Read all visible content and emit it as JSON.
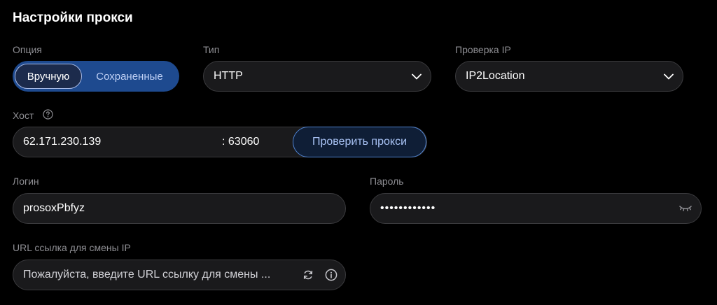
{
  "header": {
    "title": "Настройки прокси"
  },
  "option": {
    "label": "Опция",
    "tabs": [
      {
        "label": "Вручную"
      },
      {
        "label": "Сохраненные"
      }
    ]
  },
  "type": {
    "label": "Тип",
    "value": "HTTP"
  },
  "ip_check": {
    "label": "Проверка IP",
    "value": "IP2Location"
  },
  "host": {
    "label": "Хост",
    "address": "62.171.230.139",
    "port": ": 63060",
    "check_button": "Проверить прокси"
  },
  "login": {
    "label": "Логин",
    "value": "prosoxPbfyz"
  },
  "password": {
    "label": "Пароль",
    "value": "••••••••••••"
  },
  "url": {
    "label": "URL ссылка для смены IP",
    "placeholder": "Пожалуйста, введите URL ссылку для смены ..."
  },
  "icons": {
    "type_chevron": "chevron-down-icon",
    "ip_chevron": "chevron-down-icon",
    "host_help": "question-circle-icon",
    "password_toggle": "eye-closed-icon",
    "url_refresh": "refresh-icon",
    "url_info": "info-circle-icon"
  },
  "colors": {
    "background": "#000000",
    "field": "#1a1a1c",
    "accent": "#1e4a8f",
    "link": "#a9c3f5"
  }
}
